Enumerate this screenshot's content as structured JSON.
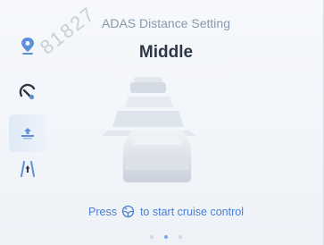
{
  "header": {
    "title": "ADAS Distance Setting",
    "current_mode": "Middle"
  },
  "sidebar": {
    "items": [
      {
        "icon": "location-pin-icon",
        "active": false
      },
      {
        "icon": "speed-limit-icon",
        "active": false
      },
      {
        "icon": "distance-setting-icon",
        "active": true
      },
      {
        "icon": "lane-assist-icon",
        "active": false
      }
    ]
  },
  "hint": {
    "prefix": "Press",
    "icon": "steering-wheel-icon",
    "suffix": "to start cruise control"
  },
  "pager": {
    "total": 3,
    "active_index": 1
  },
  "watermark": "81827",
  "colors": {
    "accent": "#4a7fd2",
    "title": "#8a99b0",
    "mode_text": "#2c3648"
  }
}
